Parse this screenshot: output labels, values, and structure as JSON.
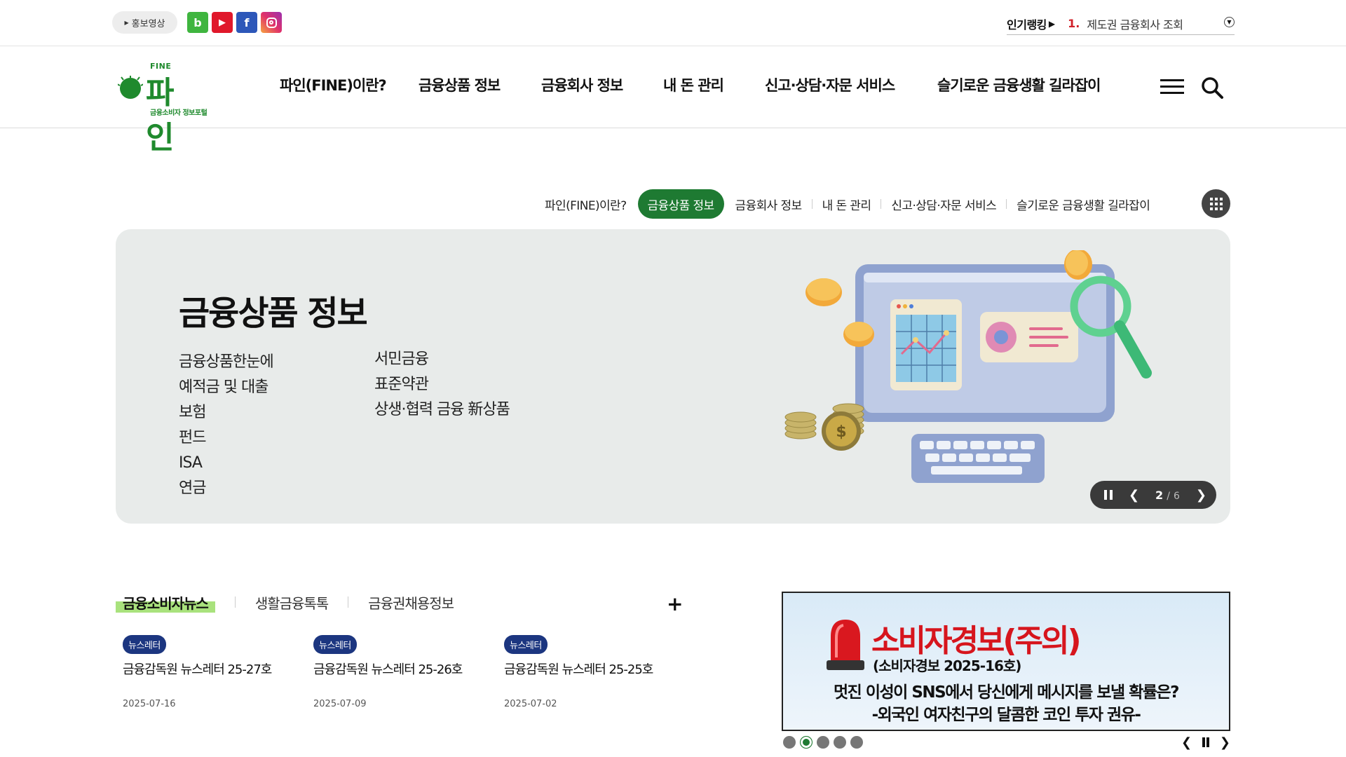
{
  "topbar": {
    "promo_video": "홍보영상",
    "sns": [
      "blog-icon",
      "youtube-icon",
      "facebook-icon",
      "instagram-icon"
    ],
    "ranking_label": "인기랭킹",
    "ranking_number": "1.",
    "ranking_text": "제도권 금융회사 조회"
  },
  "header": {
    "logo_fine": "FINE",
    "logo_name": "파인",
    "logo_sub": "금융소비자 정보포털",
    "gnb": [
      "파인(FINE)이란?",
      "금융상품 정보",
      "금융회사 정보",
      "내 돈 관리",
      "신고·상담·자문 서비스",
      "슬기로운 금융생활 길라잡이"
    ]
  },
  "subnav": {
    "items": [
      "파인(FINE)이란?",
      "금융상품 정보",
      "금융회사 정보",
      "내 돈 관리",
      "신고·상담·자문 서비스",
      "슬기로운 금융생활 길라잡이"
    ],
    "active_index": 1
  },
  "hero": {
    "title": "금융상품 정보",
    "links_col1": [
      "금융상품한눈에",
      "예적금 및 대출",
      "보험",
      "펀드",
      "ISA",
      "연금"
    ],
    "links_col2": [
      "서민금융",
      "표준약관",
      "상생·협력 금융 新상품"
    ],
    "slide_current": "2",
    "slide_separator": "/",
    "slide_total": "6"
  },
  "news": {
    "tabs": [
      "금융소비자뉴스",
      "생활금융톡톡",
      "금융권채용정보"
    ],
    "active_tab": 0,
    "more": "+",
    "items": [
      {
        "badge": "뉴스레터",
        "title": "금융감독원 뉴스레터 25-27호",
        "date": "2025-07-16"
      },
      {
        "badge": "뉴스레터",
        "title": "금융감독원 뉴스레터 25-26호",
        "date": "2025-07-09"
      },
      {
        "badge": "뉴스레터",
        "title": "금융감독원 뉴스레터 25-25호",
        "date": "2025-07-02"
      }
    ]
  },
  "banner": {
    "title": "소비자경보(주의)",
    "subtitle": "(소비자경보 2025-16호)",
    "line1": "멋진 이성이 SNS에서 당신에게 메시지를 보낼 확률은?",
    "line2": "-외국인 여자친구의 달콤한 코인 투자 권유-",
    "dot_count": 5,
    "active_dot": 1
  },
  "colors": {
    "brand_green": "#1e7a32",
    "badge_navy": "#1c3680",
    "alert_red": "#d6151d",
    "hero_bg": "#e8ebea"
  }
}
